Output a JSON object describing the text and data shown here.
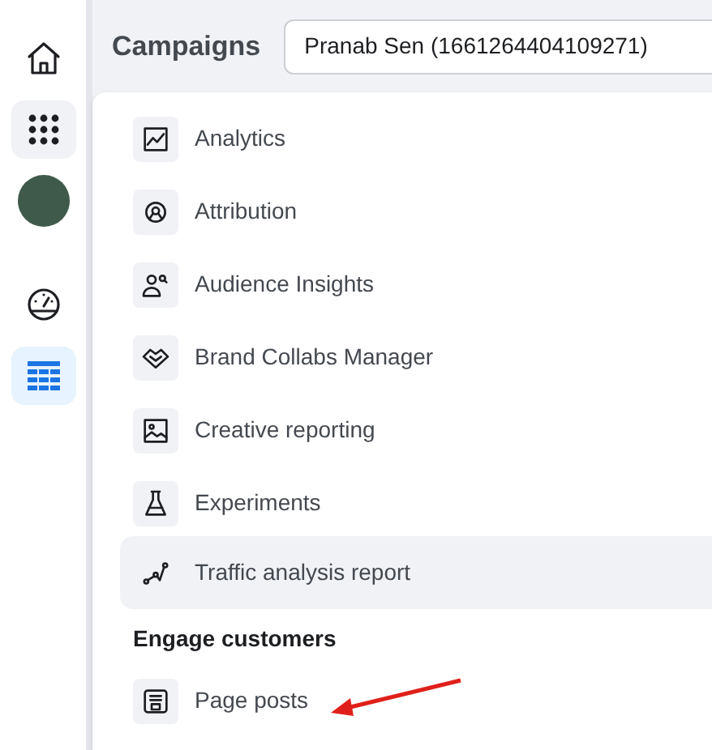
{
  "rail": [
    {
      "selected": false,
      "expanded": false
    },
    {
      "selected": false,
      "expanded": true
    },
    {
      "selected": false,
      "expanded": false
    },
    {
      "selected": false,
      "expanded": false
    },
    {
      "selected": true,
      "expanded": false
    }
  ],
  "header": {
    "title": "Campaigns",
    "account": "Pranab Sen (1661264404109271)"
  },
  "menu": {
    "sections": [
      {
        "items": [
          {
            "label": "Analytics",
            "selected": false
          },
          {
            "label": "Attribution",
            "selected": false
          },
          {
            "label": "Audience Insights",
            "selected": false
          },
          {
            "label": "Brand Collabs Manager",
            "selected": false
          },
          {
            "label": "Creative reporting",
            "selected": false
          },
          {
            "label": "Experiments",
            "selected": false
          },
          {
            "label": "Traffic analysis report",
            "selected": true
          }
        ]
      },
      {
        "heading": "Engage customers",
        "items": [
          {
            "label": "Page posts",
            "selected": false
          }
        ]
      }
    ]
  }
}
